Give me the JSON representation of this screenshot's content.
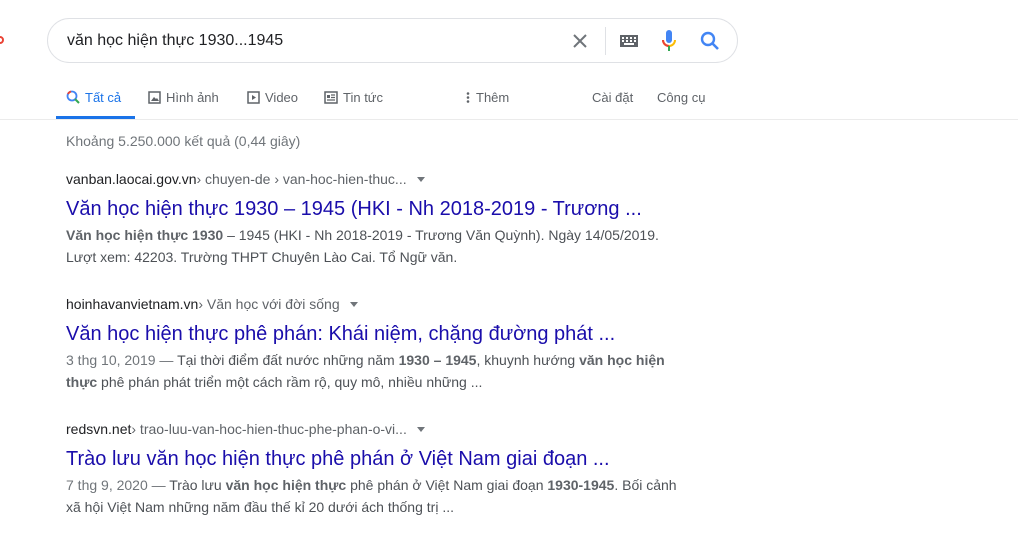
{
  "search": {
    "query": "văn học hiện thực 1930...1945"
  },
  "tabs": [
    {
      "label": "Tất cả",
      "icon": "search-icon"
    },
    {
      "label": "Hình ảnh",
      "icon": "image-icon"
    },
    {
      "label": "Video",
      "icon": "video-icon"
    },
    {
      "label": "Tin tức",
      "icon": "news-icon"
    },
    {
      "label": "Thêm",
      "icon": "more-vert-icon"
    }
  ],
  "tools": {
    "settings": "Cài đặt",
    "tools": "Công cụ"
  },
  "stats": "Khoảng 5.250.000 kết quả (0,44 giây)",
  "colors": {
    "accent": "#1a73e8",
    "link": "#1a0dab"
  },
  "results": [
    {
      "domain": "vanban.laocai.gov.vn",
      "path": " › chuyen-de › van-hoc-hien-thuc...",
      "title": "Văn học hiện thực 1930 – 1945 (HKI - Nh 2018-2019 - Trương ...",
      "snippet": [
        {
          "t": "Văn học hiện thực 1930",
          "b": true
        },
        {
          "t": " – 1945 (HKI - Nh 2018-2019 - Trương Văn Quỳnh). Ngày 14/05/2019. Lượt xem: 42203. Trường THPT Chuyên Lào Cai. Tổ Ngữ văn.",
          "b": false
        }
      ]
    },
    {
      "domain": "hoinhavanvietnam.vn",
      "path": " › Văn học với đời sống",
      "title": "Văn học hiện thực phê phán: Khái niệm, chặng đường phát ...",
      "date": "3 thg 10, 2019 — ",
      "snippet": [
        {
          "t": "Tại thời điểm đất nước những năm ",
          "b": false
        },
        {
          "t": "1930 – 1945",
          "b": true
        },
        {
          "t": ", khuynh hướng ",
          "b": false
        },
        {
          "t": "văn học hiện thực",
          "b": true
        },
        {
          "t": " phê phán phát triển một cách rầm rộ, quy mô, nhiều những ...",
          "b": false
        }
      ]
    },
    {
      "domain": "redsvn.net",
      "path": " › trao-luu-van-hoc-hien-thuc-phe-phan-o-vi...",
      "title": "Trào lưu văn học hiện thực phê phán ở Việt Nam giai đoạn ...",
      "date": "7 thg 9, 2020 — ",
      "snippet": [
        {
          "t": "Trào lưu ",
          "b": false
        },
        {
          "t": "văn học hiện thực",
          "b": true
        },
        {
          "t": " phê phán ở Việt Nam giai đoạn ",
          "b": false
        },
        {
          "t": "1930-1945",
          "b": true
        },
        {
          "t": ". Bối cảnh xã hội Việt Nam những năm đầu thế kỉ 20 dưới ách thống trị ...",
          "b": false
        }
      ]
    }
  ]
}
